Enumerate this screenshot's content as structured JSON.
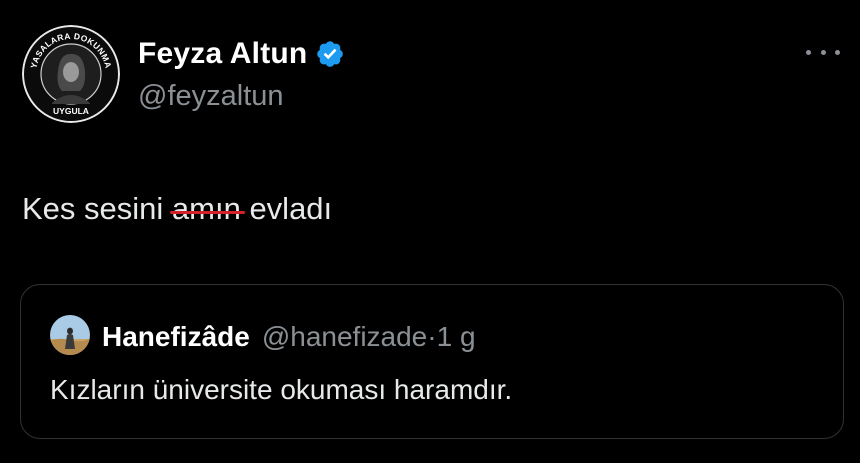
{
  "author": {
    "name": "Feyza Altun",
    "handle": "@feyzaltun",
    "avatar_ring_text_top": "YASALARA DOKUNMA",
    "avatar_ring_text_bottom": "UYGULA"
  },
  "tweet": {
    "text_before": "Kes sesini ",
    "text_struck": "amın",
    "text_after": " evladı"
  },
  "quoted_tweet": {
    "name": "Hanefizâde",
    "handle": "@hanefizade",
    "separator": "·",
    "time": "1 g",
    "text": "Kızların üniversite okuması haramdır."
  },
  "colors": {
    "background": "#000000",
    "verified_badge": "#1d9bf0",
    "strike": "#d3212c",
    "secondary_text": "#8b9095"
  },
  "icons": {
    "verified": "verified-badge-icon",
    "more": "more-options-icon"
  }
}
